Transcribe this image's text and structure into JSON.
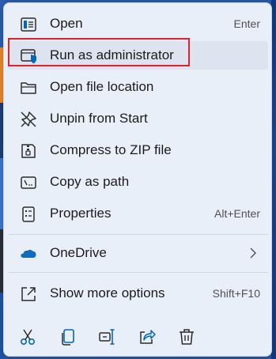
{
  "menu": {
    "items": [
      {
        "label": "Open",
        "shortcut": "Enter",
        "icon": "open-icon"
      },
      {
        "label": "Run as administrator",
        "shortcut": "",
        "icon": "shield-icon"
      },
      {
        "label": "Open file location",
        "shortcut": "",
        "icon": "folder-icon"
      },
      {
        "label": "Unpin from Start",
        "shortcut": "",
        "icon": "unpin-icon"
      },
      {
        "label": "Compress to ZIP file",
        "shortcut": "",
        "icon": "zip-icon"
      },
      {
        "label": "Copy as path",
        "shortcut": "",
        "icon": "copy-path-icon"
      },
      {
        "label": "Properties",
        "shortcut": "Alt+Enter",
        "icon": "properties-icon"
      }
    ],
    "onedrive": {
      "label": "OneDrive",
      "icon": "onedrive-icon"
    },
    "more": {
      "label": "Show more options",
      "shortcut": "Shift+F10",
      "icon": "more-options-icon"
    },
    "bottom_actions": [
      "cut-icon",
      "copy-icon",
      "rename-icon",
      "share-icon",
      "delete-icon"
    ],
    "highlighted_item": "Run as administrator"
  },
  "colors": {
    "accent": "#0067c0",
    "highlight_border": "#e0202a",
    "menu_bg": "#e9eff8"
  }
}
